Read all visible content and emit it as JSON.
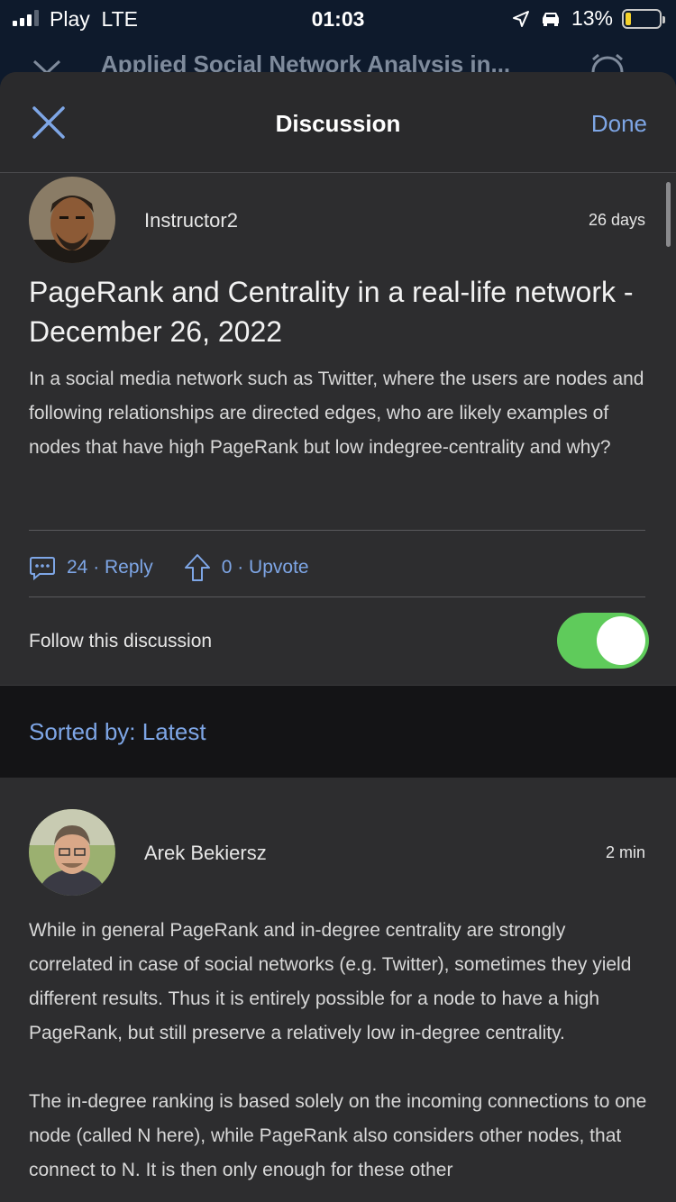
{
  "status_bar": {
    "carrier": "Play",
    "network": "LTE",
    "time": "01:03",
    "battery": "13%",
    "battery_level": 0.13
  },
  "background_nav": {
    "title": "Applied Social Network Analysis in..."
  },
  "header": {
    "title": "Discussion",
    "done_label": "Done"
  },
  "post": {
    "author": "Instructor2",
    "time": "26 days",
    "title": "PageRank and Centrality in a real-life network - December 26, 2022",
    "body": "In a social media network such as Twitter, where the users are nodes and following relationships are directed edges, who are likely examples of nodes that have high PageRank but low indegree-centrality and why?",
    "reply_label": "24 · Reply",
    "upvote_label": "0 · Upvote"
  },
  "follow": {
    "label": "Follow this discussion",
    "on": true
  },
  "sort": {
    "label": "Sorted by: Latest"
  },
  "reply": {
    "author": "Arek Bekiersz",
    "time": "2 min",
    "paragraphs": [
      "While in general PageRank and in-degree centrality are strongly correlated in case of social networks (e.g. Twitter), sometimes they yield different results. Thus it is entirely possible for a node to have a high PageRank, but still preserve a relatively low in-degree centrality.",
      "The in-degree ranking is based solely on the incoming connections to one node (called N here), while PageRank also considers other nodes, that connect to N. It is then only enough for these other"
    ]
  },
  "colors": {
    "accent": "#7ea6e6",
    "toggle_on": "#5fcb5b",
    "sheet_bg": "#2d2d2f"
  }
}
